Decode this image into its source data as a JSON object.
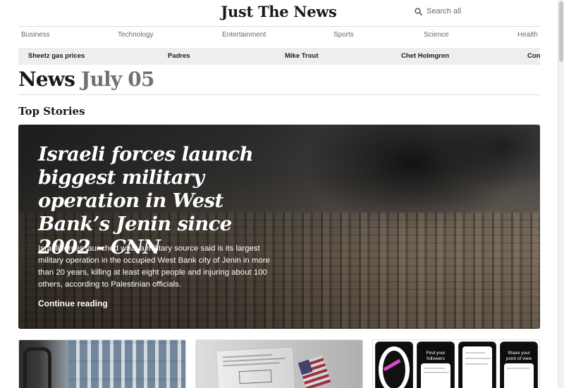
{
  "site": {
    "logo": "Just The News",
    "search_label": "Search all"
  },
  "categories": [
    "Business",
    "Technology",
    "Entertainment",
    "Sports",
    "Science",
    "Health"
  ],
  "trending": [
    "Sheetz gas prices",
    "Padres",
    "Mike Trout",
    "Chet Holmgren",
    "Con"
  ],
  "page_heading": {
    "word": "News",
    "date": "July 05"
  },
  "section_title": "Top Stories",
  "hero": {
    "title": "Israeli forces launch biggest military operation in West Bank’s Jenin since 2002 - CNN",
    "summary": "Israeli forces launched what a military source said is its largest military operation in the occupied West Bank city of Jenin in more than 20 years, killing at least eight people and injuring about 100 others, according to Palestinian officials.",
    "link": "Continue reading"
  },
  "cards": {
    "third": {
      "phone_captions": [
        "Find your followers",
        "Share your point of view"
      ]
    }
  }
}
